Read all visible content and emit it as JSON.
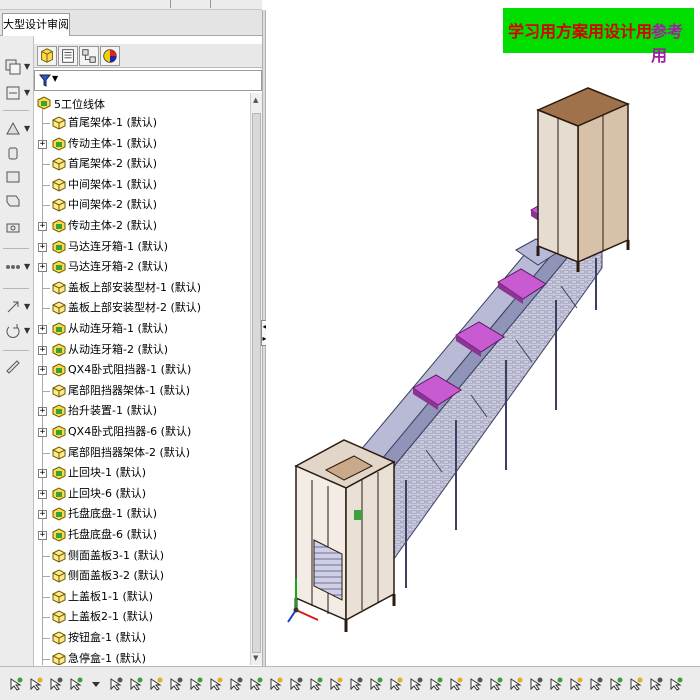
{
  "tab": {
    "label": "大型设计审阅"
  },
  "banner": {
    "learn": "学习用",
    "plan": "方案用",
    "design": "设计用",
    "reference": "参考用"
  },
  "tree": {
    "root": "5工位线体",
    "items": [
      {
        "label": "首尾架体-1 (默认)",
        "expandable": false
      },
      {
        "label": "传动主体-1 (默认)",
        "expandable": true
      },
      {
        "label": "首尾架体-2 (默认)",
        "expandable": false
      },
      {
        "label": "中间架体-1 (默认)",
        "expandable": false
      },
      {
        "label": "中间架体-2 (默认)",
        "expandable": false
      },
      {
        "label": "传动主体-2 (默认)",
        "expandable": true
      },
      {
        "label": "马达连牙箱-1 (默认)",
        "expandable": true
      },
      {
        "label": "马达连牙箱-2 (默认)",
        "expandable": true
      },
      {
        "label": "盖板上部安装型材-1 (默认)",
        "expandable": false
      },
      {
        "label": "盖板上部安装型材-2 (默认)",
        "expandable": false
      },
      {
        "label": "从动连牙箱-1 (默认)",
        "expandable": true
      },
      {
        "label": "从动连牙箱-2 (默认)",
        "expandable": true
      },
      {
        "label": "QX4卧式阻挡器-1 (默认)",
        "expandable": true
      },
      {
        "label": "尾部阻挡器架体-1 (默认)",
        "expandable": false
      },
      {
        "label": "抬升装置-1 (默认)",
        "expandable": true
      },
      {
        "label": "QX4卧式阻挡器-6 (默认)",
        "expandable": true
      },
      {
        "label": "尾部阻挡器架体-2 (默认)",
        "expandable": false
      },
      {
        "label": "止回块-1 (默认)",
        "expandable": true
      },
      {
        "label": "止回块-6 (默认)",
        "expandable": true
      },
      {
        "label": "托盘底盘-1 (默认)",
        "expandable": true
      },
      {
        "label": "托盘底盘-6 (默认)",
        "expandable": true
      },
      {
        "label": "侧面盖板3-1 (默认)",
        "expandable": false
      },
      {
        "label": "侧面盖板3-2 (默认)",
        "expandable": false
      },
      {
        "label": "上盖板1-1 (默认)",
        "expandable": false
      },
      {
        "label": "上盖板2-1 (默认)",
        "expandable": false
      },
      {
        "label": "按钮盒-1 (默认)",
        "expandable": false
      },
      {
        "label": "急停盒-1 (默认)",
        "expandable": false
      }
    ]
  },
  "icons": {
    "assembly": "assembly-icon",
    "part": "part-icon",
    "filter": "filter-icon"
  },
  "colors": {
    "banner_bg": "#00dd00",
    "banner_text": "#d80000",
    "pallet": "#c85ad2",
    "frame": "#8a8fb0",
    "box_top": "#a0724c"
  }
}
